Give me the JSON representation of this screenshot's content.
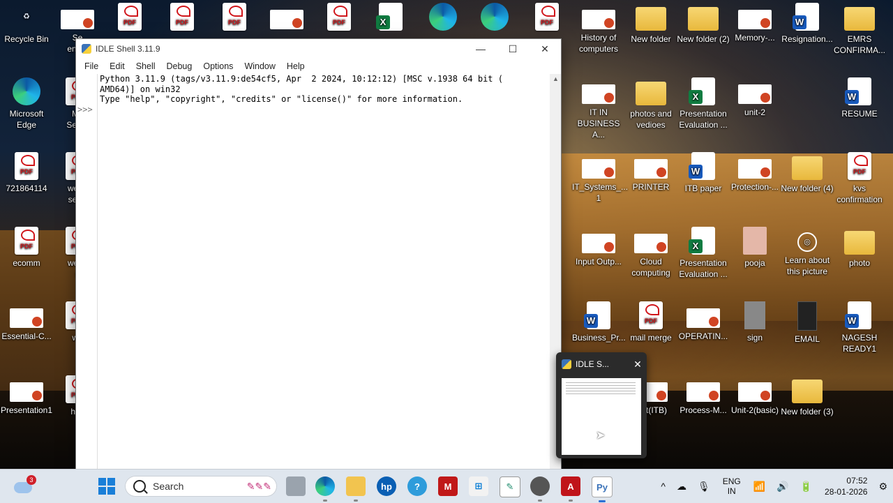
{
  "desktop": {
    "icons": [
      {
        "label": "Recycle Bin",
        "kind": "recycle"
      },
      {
        "label": "Se\nengin",
        "kind": "ppt"
      },
      {
        "label": "",
        "kind": "pdf-red"
      },
      {
        "label": "",
        "kind": "pdf"
      },
      {
        "label": "",
        "kind": "pdf"
      },
      {
        "label": "",
        "kind": "ppt"
      },
      {
        "label": "",
        "kind": "pdf"
      },
      {
        "label": "",
        "kind": "excel"
      },
      {
        "label": "",
        "kind": "edge"
      },
      {
        "label": "",
        "kind": "edge"
      },
      {
        "label": "",
        "kind": "pdf"
      },
      {
        "label": "History of computers",
        "kind": "ppt"
      },
      {
        "label": "New folder",
        "kind": "folder"
      },
      {
        "label": "New folder (2)",
        "kind": "folder"
      },
      {
        "label": "Memory-...",
        "kind": "ppt"
      },
      {
        "label": "Resignation...",
        "kind": "word"
      },
      {
        "label": "EMRS CONFIRMA...",
        "kind": "folder"
      },
      {
        "label": "Microsoft Edge",
        "kind": "edge"
      },
      {
        "label": "Mc\nSecur",
        "kind": "pdf"
      },
      {
        "label": "IT IN BUSINESS A...",
        "kind": "ppt"
      },
      {
        "label": "photos and vedioes",
        "kind": "folder"
      },
      {
        "label": "Presentation Evaluation ...",
        "kind": "excel"
      },
      {
        "label": "unit-2",
        "kind": "ppt"
      },
      {
        "label": "RESUME",
        "kind": "word"
      },
      {
        "label": "721864114",
        "kind": "pdf"
      },
      {
        "label": "webs\nseo -",
        "kind": "pdf"
      },
      {
        "label": "IT_Systems_...\n1",
        "kind": "ppt"
      },
      {
        "label": "PRINTER",
        "kind": "ppt"
      },
      {
        "label": "ITB paper",
        "kind": "word"
      },
      {
        "label": "Protection-...",
        "kind": "ppt"
      },
      {
        "label": "New folder (4)",
        "kind": "folder"
      },
      {
        "label": "kvs confirmation",
        "kind": "pdf"
      },
      {
        "label": "ecomm",
        "kind": "pdf"
      },
      {
        "label": "webs\ns",
        "kind": "pdf"
      },
      {
        "label": "Input Outp...",
        "kind": "ppt"
      },
      {
        "label": "Cloud computing",
        "kind": "ppt"
      },
      {
        "label": "Presentation Evaluation ...",
        "kind": "excel"
      },
      {
        "label": "pooja",
        "kind": "photo"
      },
      {
        "label": "Learn about this picture",
        "kind": "circle"
      },
      {
        "label": "photo",
        "kind": "folder"
      },
      {
        "label": "Essential-C...",
        "kind": "ppt"
      },
      {
        "label": "we",
        "kind": "pdf"
      },
      {
        "label": "Business_Pr...",
        "kind": "word"
      },
      {
        "label": "mail merge",
        "kind": "pdf"
      },
      {
        "label": "OPERATIN...",
        "kind": "ppt"
      },
      {
        "label": "sign",
        "kind": "gray"
      },
      {
        "label": "EMAIL",
        "kind": "dark"
      },
      {
        "label": "NAGESH READY1",
        "kind": "word"
      },
      {
        "label": "Presentation1",
        "kind": "ppt"
      },
      {
        "label": "hac",
        "kind": "pdf"
      },
      {
        "label": "unit(ITB)",
        "kind": "ppt"
      },
      {
        "label": "Process-M...",
        "kind": "ppt"
      },
      {
        "label": "Unit-2(basic)",
        "kind": "ppt"
      },
      {
        "label": "New folder (3)",
        "kind": "folder"
      }
    ]
  },
  "window": {
    "title": "IDLE Shell 3.11.9",
    "minimize": "—",
    "maximize": "☐",
    "close": "✕",
    "menu": [
      "File",
      "Edit",
      "Shell",
      "Debug",
      "Options",
      "Window",
      "Help"
    ],
    "prompt": ">>>",
    "shell_text": "Python 3.11.9 (tags/v3.11.9:de54cf5, Apr  2 2024, 10:12:12) [MSC v.1938 64 bit (\nAMD64)] on win32\nType \"help\", \"copyright\", \"credits\" or \"license()\" for more information."
  },
  "preview": {
    "title": "IDLE S...",
    "close": "✕"
  },
  "taskbar": {
    "weather_badge": "3",
    "search_placeholder": "Search",
    "apps": [
      "task-view",
      "edge",
      "file-explorer",
      "hp",
      "help",
      "mcafee",
      "store",
      "whiteboard",
      "chrome-like",
      "acrobat",
      "idle"
    ],
    "tray": {
      "chevron": "^",
      "lang_top": "ENG",
      "lang_bottom": "IN",
      "time": "07:52",
      "date": "28-01-2026"
    }
  },
  "colors": {
    "accent": "#2a6fd4",
    "pdf_red": "#d0161b",
    "taskbar": "#dfe6ee"
  }
}
